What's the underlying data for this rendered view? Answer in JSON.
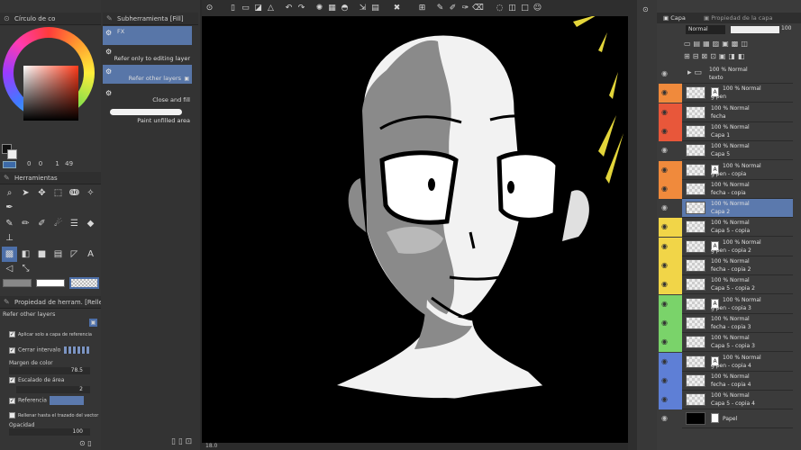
{
  "app": {
    "colors": {
      "orange": "#f08a3c",
      "red": "#e8573a",
      "yellow": "#f1d548",
      "green": "#7ad36a",
      "blue": "#5e7fd6",
      "accent": "#5b79ad"
    }
  },
  "left_panel": {
    "color_wheel_title": "Círculo de co",
    "color_readout": [
      "0",
      "0",
      "1",
      "49"
    ],
    "tools_title": "Herramientas",
    "props_title": "Propiedad de herram. [Rellen",
    "props_subtitle": "Refer other layers",
    "props": {
      "apply_label": "Aplicar solo a capa de referencia",
      "gap_label": "Cerrar intervalo",
      "margin_label": "Margen de color",
      "margin_value": "78.5",
      "area_label": "Escalado de área",
      "area_value": "2",
      "ref_label": "Referencia",
      "fill_label": "Rellenar hasta el trazado del vector",
      "opacity_label": "Opacidad",
      "opacity_value": "100"
    }
  },
  "sub_tool_panel": {
    "title": "Subherramienta [Fill]",
    "items": [
      {
        "label": "FX"
      },
      {
        "label": "Refer only to editing layer"
      },
      {
        "label": "Refer other layers"
      },
      {
        "label": "Close and fill"
      },
      {
        "label": "Paint unfilled area"
      }
    ]
  },
  "canvas": {
    "zoom": "18.0",
    "bg": "#000000"
  },
  "layer_panel": {
    "tab_layer": "Capa",
    "tab_props": "Propiedad de la capa",
    "blend_mode": "Normal",
    "opacity": "100",
    "layers": [
      {
        "line1": "100 % Normal",
        "line2": "texto",
        "color": "",
        "folder": true
      },
      {
        "line1": "100 % Normal",
        "line2": "g pen",
        "color": "orange",
        "mark": "A"
      },
      {
        "line1": "100 % Normal",
        "line2": "fecha",
        "color": "red"
      },
      {
        "line1": "100 % Normal",
        "line2": "Capa 1",
        "color": "red"
      },
      {
        "line1": "100 % Normal",
        "line2": "Capa 5",
        "color": ""
      },
      {
        "line1": "100 % Normal",
        "line2": "g pen - copia",
        "color": "orange",
        "mark": "A"
      },
      {
        "line1": "100 % Normal",
        "line2": "fecha - copia",
        "color": "orange"
      },
      {
        "line1": "100 % Normal",
        "line2": "Capa 2",
        "color": "",
        "selected": true
      },
      {
        "line1": "100 % Normal",
        "line2": "Capa 5 - copia",
        "color": "yellow"
      },
      {
        "line1": "100 % Normal",
        "line2": "g pen - copia 2",
        "color": "yellow",
        "mark": "A"
      },
      {
        "line1": "100 % Normal",
        "line2": "fecha - copia 2",
        "color": "yellow"
      },
      {
        "line1": "100 % Normal",
        "line2": "Capa 5 - copia 2",
        "color": "yellow"
      },
      {
        "line1": "100 % Normal",
        "line2": "g pen - copia 3",
        "color": "green",
        "mark": "A"
      },
      {
        "line1": "100 % Normal",
        "line2": "fecha - copia 3",
        "color": "green"
      },
      {
        "line1": "100 % Normal",
        "line2": "Capa 5 - copia 3",
        "color": "green"
      },
      {
        "line1": "100 % Normal",
        "line2": "g pen - copia 4",
        "color": "blue",
        "mark": "A"
      },
      {
        "line1": "100 % Normal",
        "line2": "fecha - copia 4",
        "color": "blue"
      },
      {
        "line1": "100 % Normal",
        "line2": "Capa 5 - copia 4",
        "color": "blue"
      },
      {
        "line1": "",
        "line2": "Papel",
        "color": "",
        "paper": true
      }
    ]
  }
}
